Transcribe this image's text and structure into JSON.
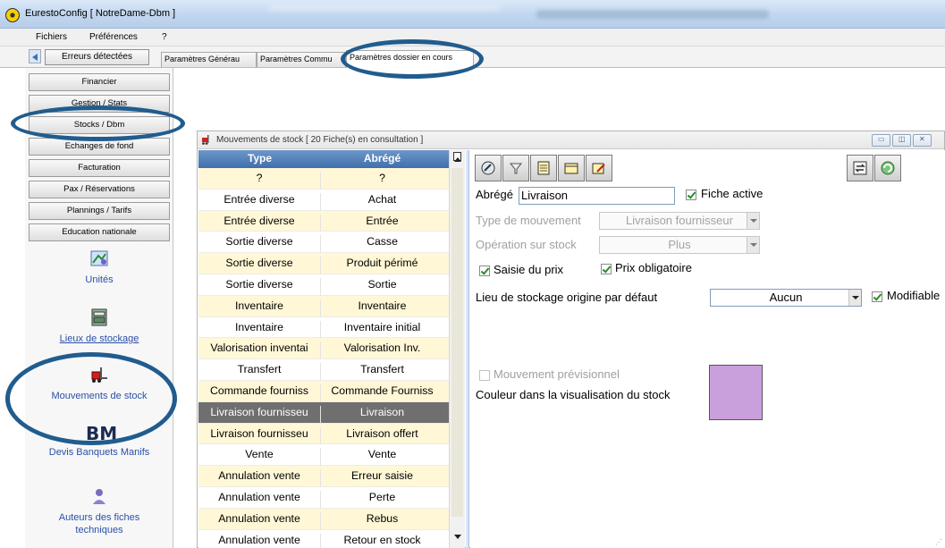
{
  "window": {
    "title": "EurestoConfig [ NotreDame-Dbm ]"
  },
  "menu": [
    "Fichiers",
    "Préférences",
    "?"
  ],
  "toolbar": {
    "errors_button": "Erreurs détectées"
  },
  "tabs": [
    "Paramètres Générau",
    "Paramètres Commu",
    "Paramètres dossier en cours"
  ],
  "nav": {
    "buttons": [
      "Financier",
      "Gestion / Stats",
      "Stocks / Dbm",
      "Echanges de fond",
      "Facturation",
      "Pax / Réservations",
      "Plannings / Tarifs",
      "Education nationale"
    ],
    "tiles": [
      "Unités",
      "Lieux de stockage",
      "Mouvements de stock",
      "Devis Banquets Manifs",
      "Auteurs des fiches techniques"
    ],
    "tile_icons": [
      "units-icon",
      "storage-places-icon",
      "forklift-icon",
      "bm-icon",
      "authors-icon"
    ],
    "tile_badge_text": "BM"
  },
  "inner_window": {
    "title": "Mouvements de stock  [ 20 Fiche(s) en consultation ]",
    "buttons": [
      "minimize",
      "restore",
      "close"
    ]
  },
  "grid": {
    "columns": [
      "Type",
      "Abrégé"
    ],
    "rows": [
      [
        "?",
        "?"
      ],
      [
        "Entrée diverse",
        "Achat"
      ],
      [
        "Entrée diverse",
        "Entrée"
      ],
      [
        "Sortie diverse",
        "Casse"
      ],
      [
        "Sortie diverse",
        "Produit périmé"
      ],
      [
        "Sortie diverse",
        "Sortie"
      ],
      [
        "Inventaire",
        "Inventaire"
      ],
      [
        "Inventaire",
        "Inventaire initial"
      ],
      [
        "Valorisation inventai",
        "Valorisation Inv."
      ],
      [
        "Transfert",
        "Transfert"
      ],
      [
        "Commande fourniss",
        "Commande Fourniss"
      ],
      [
        "Livraison fournisseu",
        "Livraison"
      ],
      [
        "Livraison fournisseu",
        "Livraison offert"
      ],
      [
        "Vente",
        "Vente"
      ],
      [
        "Annulation vente",
        "Erreur saisie"
      ],
      [
        "Annulation vente",
        "Perte"
      ],
      [
        "Annulation vente",
        "Rebus"
      ],
      [
        "Annulation vente",
        "Retour en stock"
      ]
    ],
    "selected_row": 11
  },
  "form": {
    "toolbar_icons": [
      "attach-icon",
      "filter-icon",
      "list-icon",
      "folder-icon",
      "edit-icon",
      "transfer-icon",
      "refresh-icon"
    ],
    "abrege_label": "Abrégé",
    "abrege_value": "Livraison",
    "fiche_active_label": "Fiche active",
    "fiche_active": true,
    "type_mouvement_label": "Type de mouvement",
    "type_mouvement_value": "Livraison fournisseur",
    "operation_label": "Opération sur stock",
    "operation_value": "Plus",
    "saisie_prix_label": "Saisie du prix",
    "saisie_prix": true,
    "prix_obligatoire_label": "Prix obligatoire",
    "prix_obligatoire": true,
    "lieu_label": "Lieu de stockage origine par défaut",
    "lieu_value": "Aucun",
    "modifiable_label": "Modifiable",
    "modifiable": true,
    "previsionnel_label": "Mouvement prévisionnel",
    "previsionnel": false,
    "couleur_label": "Couleur dans la visualisation du stock",
    "couleur": "#c9a0dc"
  },
  "colors": {
    "highlight_ring": "#215c8e",
    "grid_header": "#4f7dbb",
    "selected_row": "#6f6f6f",
    "alt_row": "#fff7d6"
  }
}
